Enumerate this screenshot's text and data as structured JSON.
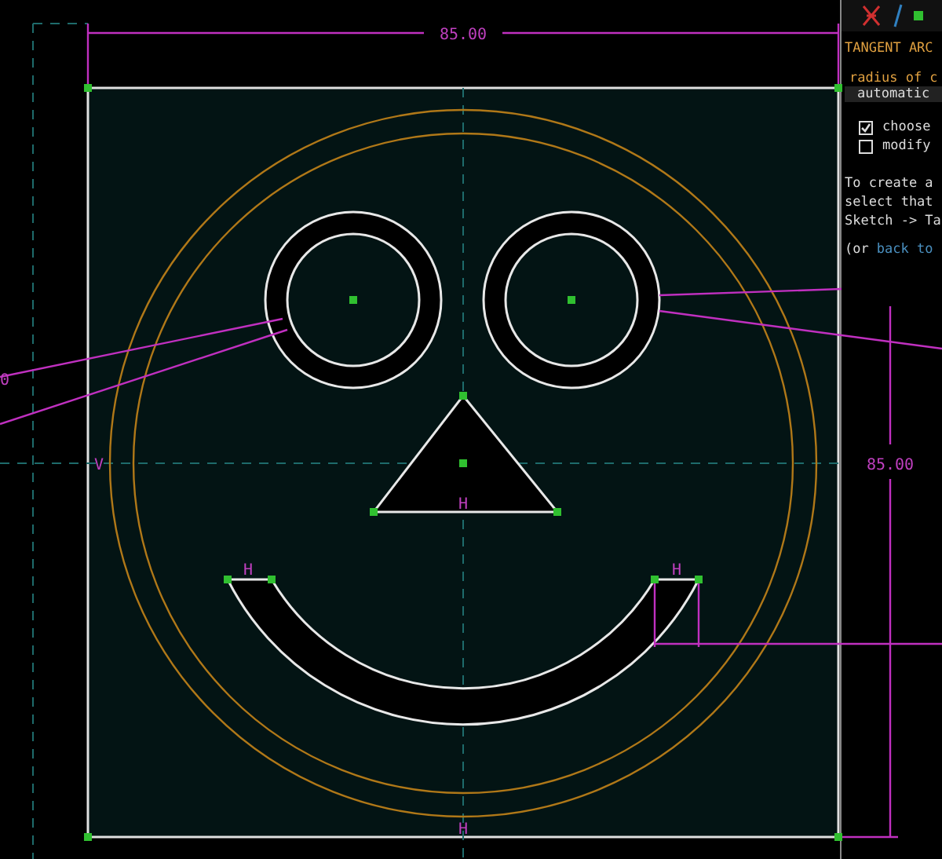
{
  "canvas": {
    "dimension_labels": [
      "85.00",
      "85.00",
      "0"
    ],
    "constraint_labels": [
      {
        "text": "V"
      },
      {
        "text": "H"
      },
      {
        "text": "H"
      },
      {
        "text": "H"
      },
      {
        "text": "H"
      }
    ]
  },
  "panel": {
    "title": "TANGENT ARC",
    "radius_label": "radius of c",
    "radius_value": "automatic",
    "options": [
      {
        "label": "choose",
        "checked": true
      },
      {
        "label": "modify",
        "checked": false
      }
    ],
    "instructions": [
      "To create a",
      "select that",
      "Sketch -> Ta"
    ],
    "back_prefix": "(or",
    "back_link": "back to"
  }
}
